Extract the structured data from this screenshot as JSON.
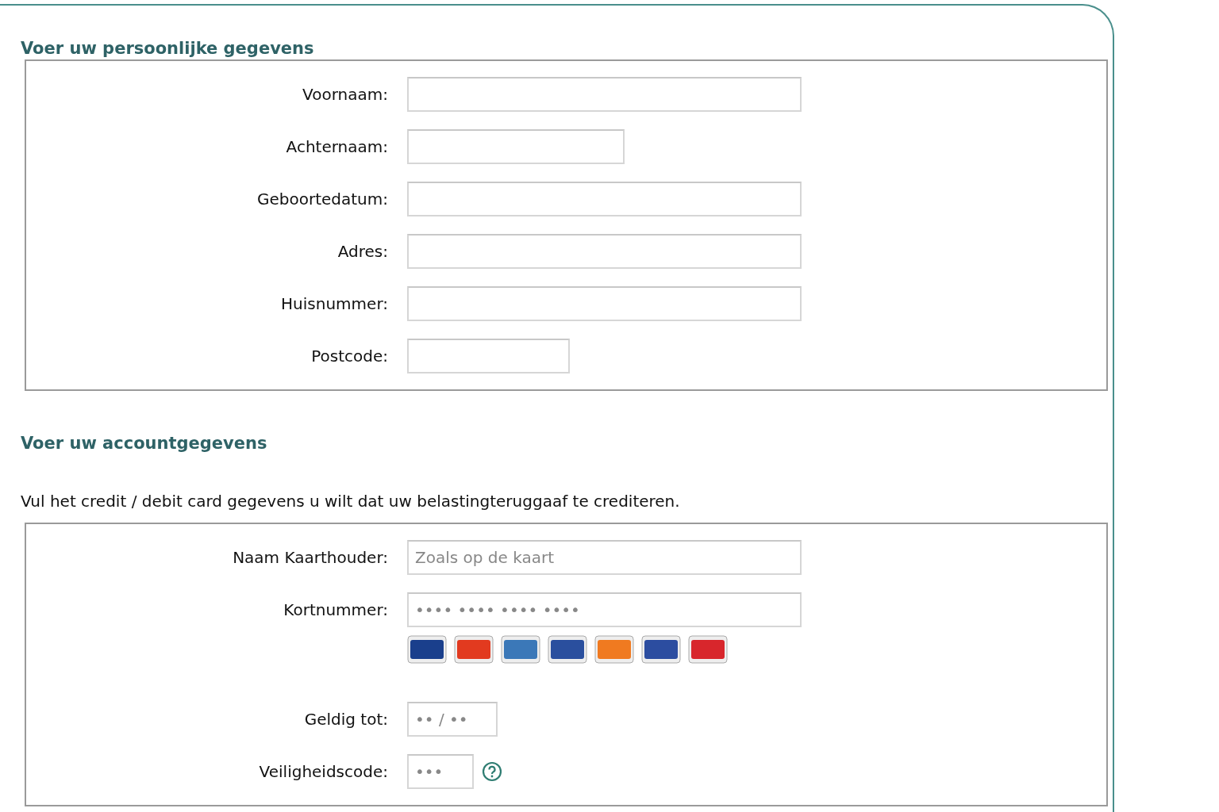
{
  "sections": [
    {
      "heading": "Voer uw persoonlijke gegevens",
      "fields": [
        {
          "label": "Voornaam:",
          "kind": "wide"
        },
        {
          "label": "Achternaam:",
          "kind": "medium"
        },
        {
          "label": "Geboortedatum:",
          "kind": "wide"
        },
        {
          "label": "Adres:",
          "kind": "wide"
        },
        {
          "label": "Huisnummer:",
          "kind": "wide"
        },
        {
          "label": "Postcode:",
          "kind": "small"
        }
      ]
    },
    {
      "heading": "Voer uw accountgegevens",
      "intro": "Vul het credit / debit card gegevens u wilt dat uw belastingteruggaaf te crediteren.",
      "fields": [
        {
          "label": "Naam Kaarthouder:",
          "kind": "wide",
          "placeholder": "Zoals op de kaart"
        },
        {
          "label": "Kortnummer:",
          "kind": "wide",
          "placeholder": "•••• •••• •••• ••••",
          "card_logos": [
            {
              "color": "#1a3f8c"
            },
            {
              "color": "#e23a1f"
            },
            {
              "color": "#3b78b8"
            },
            {
              "color": "#2a4f9e"
            },
            {
              "color": "#f07a20"
            },
            {
              "color": "#2c4da0"
            },
            {
              "color": "#d8262c"
            }
          ]
        },
        {
          "label": "Geldig tot:",
          "kind": "tiny",
          "placeholder": "•• / ••"
        },
        {
          "label": "Veiligheidscode:",
          "kind": "mini",
          "placeholder": "•••",
          "help": true
        }
      ]
    }
  ]
}
